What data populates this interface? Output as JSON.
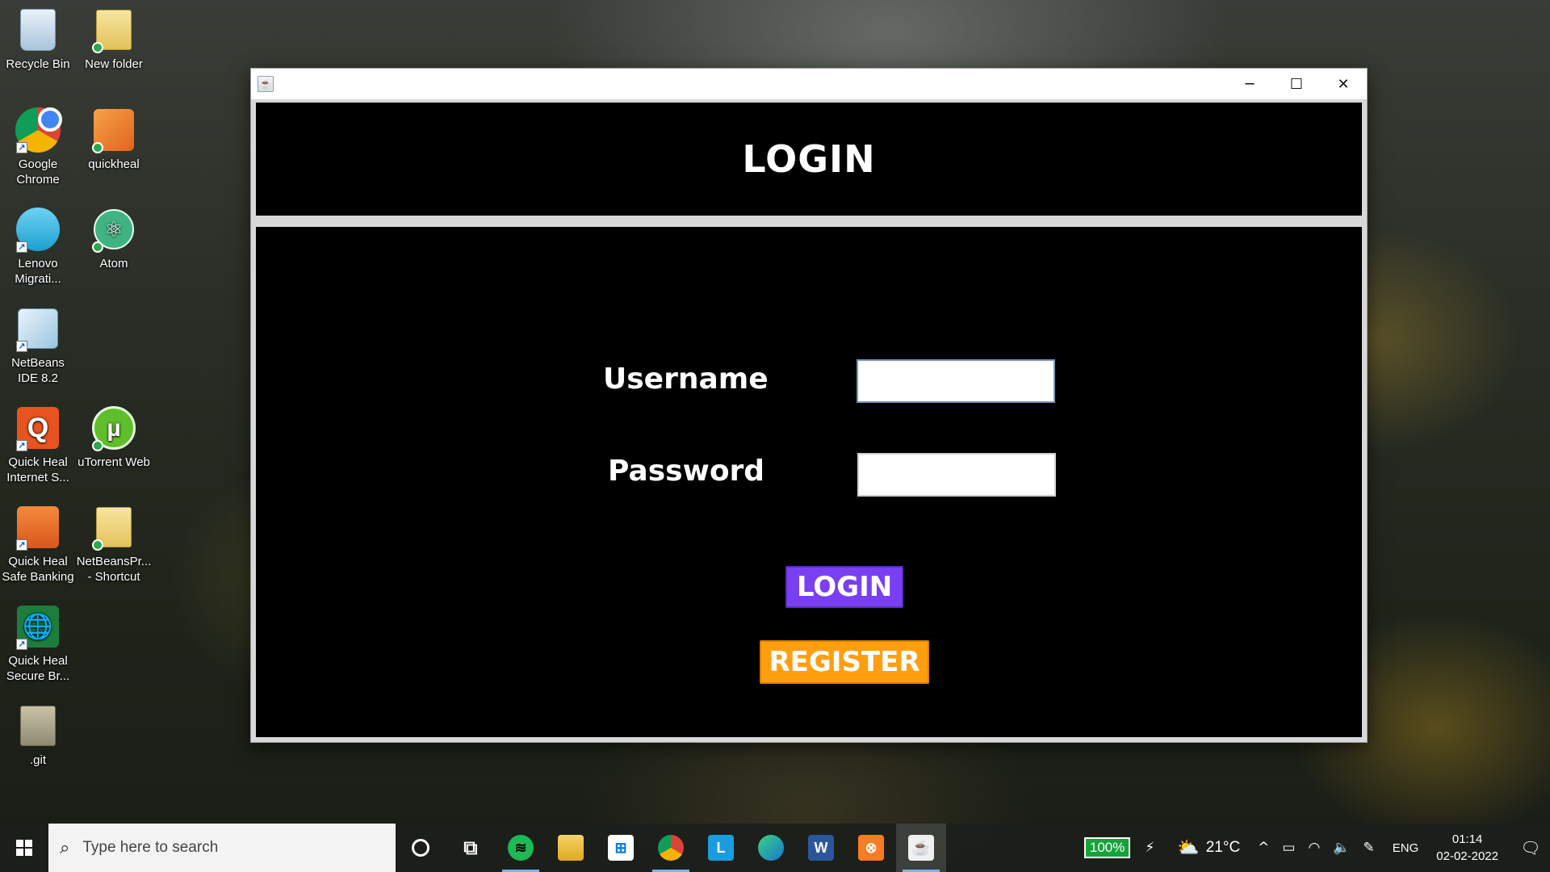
{
  "desktop": {
    "icons": [
      {
        "label": "Recycle Bin"
      },
      {
        "label": "New folder"
      },
      {
        "label": "Google Chrome"
      },
      {
        "label": "quickheal"
      },
      {
        "label": "Lenovo Migrati..."
      },
      {
        "label": "Atom"
      },
      {
        "label": "NetBeans IDE 8.2"
      },
      {
        "label": "Quick Heal Internet S..."
      },
      {
        "label": "uTorrent Web"
      },
      {
        "label": "Quick Heal Safe Banking"
      },
      {
        "label": "NetBeansPr... - Shortcut"
      },
      {
        "label": "Quick Heal Secure Br..."
      },
      {
        "label": ".git"
      }
    ]
  },
  "window": {
    "controls": {
      "minimize": "─",
      "maximize": "☐",
      "close": "✕"
    },
    "header_title": "LOGIN",
    "form": {
      "username_label": "Username",
      "username_value": "",
      "password_label": "Password",
      "password_value": "",
      "login_button": "LOGIN",
      "register_button": "REGISTER"
    },
    "colors": {
      "login_button": "#7a3ff2",
      "register_button": "#ff9f10",
      "panel_background": "#000000"
    }
  },
  "taskbar": {
    "search_placeholder": "Type here to search",
    "apps": [
      {
        "name": "cortana-icon"
      },
      {
        "name": "task-view-icon"
      },
      {
        "name": "spotify-icon"
      },
      {
        "name": "file-explorer-icon"
      },
      {
        "name": "microsoft-store-icon"
      },
      {
        "name": "chrome-icon"
      },
      {
        "name": "l-app-icon"
      },
      {
        "name": "edge-icon"
      },
      {
        "name": "word-icon"
      },
      {
        "name": "xampp-icon"
      },
      {
        "name": "java-app-icon",
        "active": true
      }
    ],
    "tray": {
      "battery": "100%",
      "temperature": "21°C",
      "language": "ENG",
      "time": "01:14",
      "date": "02-02-2022"
    }
  }
}
